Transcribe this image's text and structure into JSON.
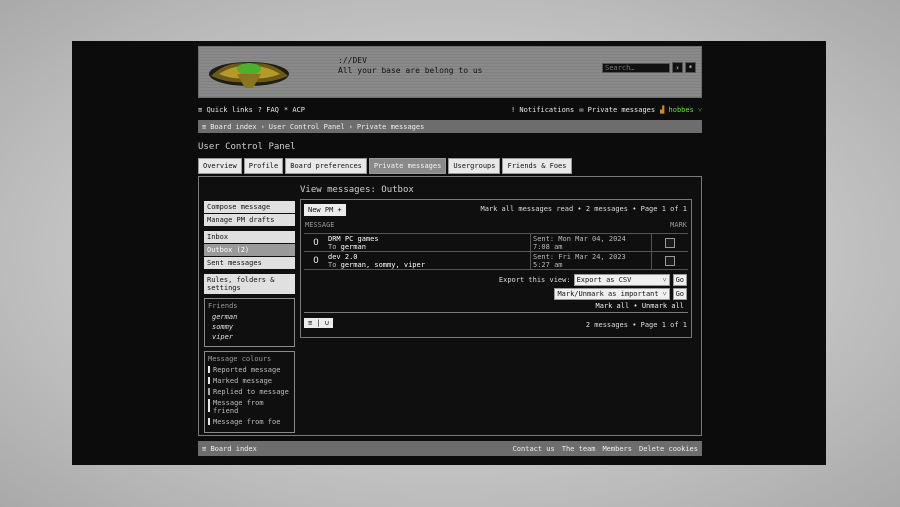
{
  "site": {
    "title": "://DEV",
    "description": "All your base are belong to us"
  },
  "search": {
    "placeholder": "Search…",
    "go_symbol": "›",
    "advanced_symbol": "*"
  },
  "navbar": {
    "quick_links": "Quick links",
    "faq": "FAQ",
    "acp": "ACP",
    "notifications": "Notifications",
    "private_messages": "Private messages",
    "username": "hobbes"
  },
  "breadcrumb": [
    "Board index",
    "User Control Panel",
    "Private messages"
  ],
  "page_title": "User Control Panel",
  "tabs": [
    "Overview",
    "Profile",
    "Board preferences",
    "Private messages",
    "Usergroups",
    "Friends & Foes"
  ],
  "sidebar": {
    "group1": [
      "Compose message",
      "Manage PM drafts"
    ],
    "group2": [
      "Inbox",
      "Outbox (2)",
      "Sent messages"
    ],
    "group3": [
      "Rules, folders & settings"
    ],
    "friends_title": "Friends",
    "friends": [
      "german",
      "sommy",
      "viper"
    ],
    "colours_title": "Message colours",
    "colours": [
      "Reported message",
      "Marked message",
      "Replied to message",
      "Message from friend",
      "Message from foe"
    ]
  },
  "main": {
    "title": "View messages: Outbox",
    "new_pm": "New PM +",
    "top_info": "Mark all messages read • 2 messages • Page 1 of 1",
    "col_message": "MESSAGE",
    "col_mark": "MARK",
    "messages": [
      {
        "subject": "DRM PC games",
        "to_label": "To",
        "to": "german",
        "sent": "Sent: Mon Mar 04, 2024",
        "time": "7:08 am"
      },
      {
        "subject": "dev 2.0",
        "to_label": "To",
        "to": "german, sommy, viper",
        "sent": "Sent: Fri Mar 24, 2023",
        "time": "5:27 am"
      }
    ],
    "export_label": "Export this view:",
    "export_value": "Export as CSV",
    "go": "Go",
    "mark_action": "Mark/Unmark as important",
    "mark_all": "Mark all • Unmark all",
    "paging": "≡ | ∪",
    "bottom_info": "2 messages • Page 1 of 1"
  },
  "footer": {
    "board_index": "Board index",
    "links": [
      "Contact us",
      "The team",
      "Members",
      "Delete cookies"
    ]
  }
}
